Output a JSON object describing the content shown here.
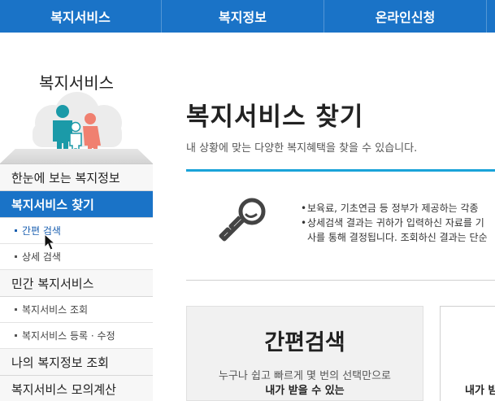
{
  "topnav": {
    "items": [
      "복지서비스",
      "복지정보",
      "온라인신청"
    ]
  },
  "sidebar": {
    "title": "복지서비스",
    "menu": {
      "overview": "한눈에 보는 복지정보",
      "find": "복지서비스 찾기",
      "find_simple": "간편 검색",
      "find_detail": "상세 검색",
      "private": "민간 복지서비스",
      "private_search": "복지서비스 조회",
      "private_register": "복지서비스 등록 · 수정",
      "my_info": "나의 복지정보 조회",
      "simulation": "복지서비스 모의계산"
    }
  },
  "main": {
    "title": "복지서비스 찾기",
    "subtitle": "내 상황에 맞는 다양한 복지혜택을 찾을 수 있습니다.",
    "bullets": {
      "b1": "보육료, 기초연금 등 정부가 제공하는 각종",
      "b2_line1": "상세검색 결과는 귀하가 입력하신 자료를 기",
      "b2_line2": "사를 통해 결정됩니다. 조회하신 결과는 단순"
    },
    "card_simple": {
      "title": "간편검색",
      "desc": "누구나 쉽고 빠르게 몇 번의 선택만으로",
      "bold": "내가 받을 수 있는"
    },
    "card_detail": {
      "bold": "내가 받"
    }
  },
  "colors": {
    "nav_blue": "#1a73c7",
    "accent_cyan": "#1aa3d9",
    "figure_teal": "#1b9aa8",
    "figure_coral": "#f08070"
  }
}
